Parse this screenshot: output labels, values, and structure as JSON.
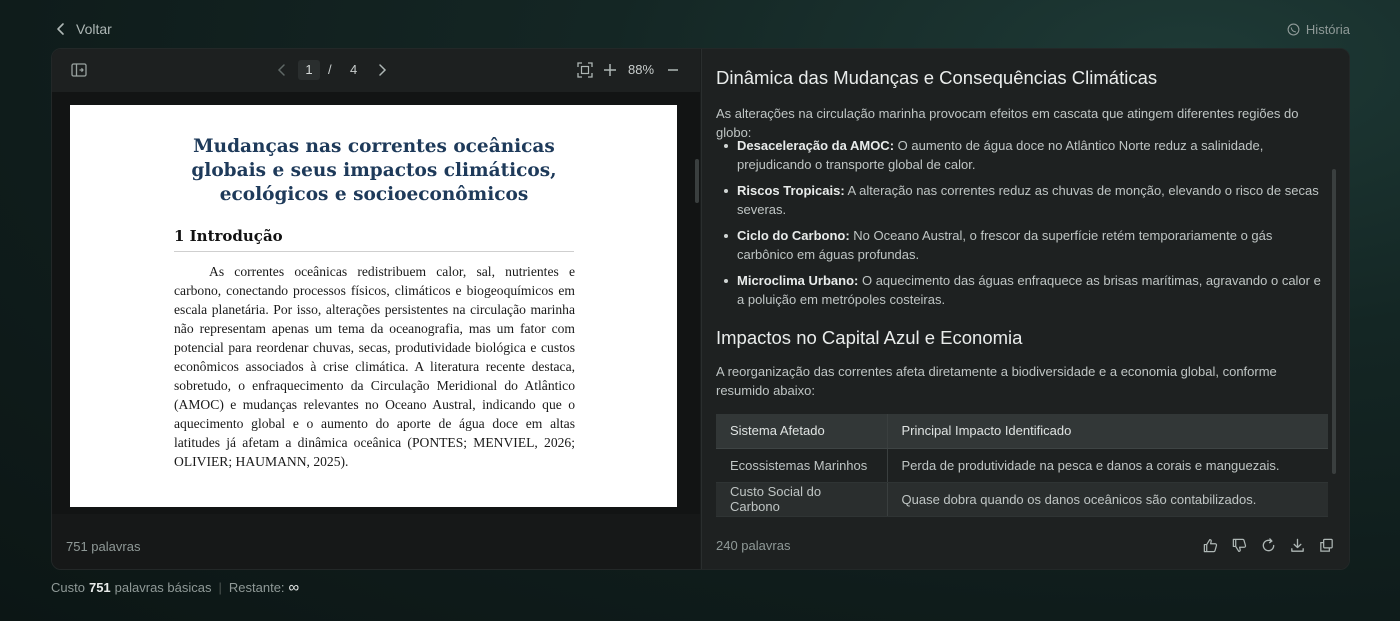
{
  "nav": {
    "back_label": "Voltar",
    "history_label": "História"
  },
  "viewer": {
    "current_page": "1",
    "page_separator": "/",
    "total_pages": "4",
    "zoom": "88%",
    "word_count": "751 palavras"
  },
  "document": {
    "title": "Mudanças nas correntes oceânicas globais e seus impactos climáticos, ecológicos e socioeconômicos",
    "section_heading": "1 Introdução",
    "body": "As correntes oceânicas redistribuem calor, sal, nutrientes e carbono, conectando processos físicos, climáticos e biogeoquímicos em escala planetária. Por isso, alterações persistentes na circulação marinha não representam apenas um tema da oceanografia, mas um fator com potencial para reordenar chuvas, secas, produtividade biológica e custos econômicos associados à crise climática. A literatura recente destaca, sobretudo, o enfraquecimento da Circulação Meridional do Atlântico (AMOC) e mudanças relevantes no Oceano Austral, indicando que o aquecimento global e o aumento do aporte de água doce em altas latitudes já afetam a dinâmica oceânica (PONTES; MENVIEL, 2026; OLIVIER; HAUMANN, 2025)."
  },
  "summary": {
    "heading1": "Dinâmica das Mudanças e Consequências Climáticas",
    "intro1": "As alterações na circulação marinha provocam efeitos em cascata que atingem diferentes regiões do globo:",
    "bullets": [
      {
        "term": "Desaceleração da AMOC:",
        "text": " O aumento de água doce no Atlântico Norte reduz a salinidade, prejudicando o transporte global de calor."
      },
      {
        "term": "Riscos Tropicais:",
        "text": " A alteração nas correntes reduz as chuvas de monção, elevando o risco de secas severas."
      },
      {
        "term": "Ciclo do Carbono:",
        "text": " No Oceano Austral, o frescor da superfície retém temporariamente o gás carbônico em águas profundas."
      },
      {
        "term": "Microclima Urbano:",
        "text": " O aquecimento das águas enfraquece as brisas marítimas, agravando o calor e a poluição em metrópoles costeiras."
      }
    ],
    "heading2": "Impactos no Capital Azul e Economia",
    "intro2": "A reorganização das correntes afeta diretamente a biodiversidade e a economia global, conforme resumido abaixo:",
    "table": {
      "headers": [
        "Sistema Afetado",
        "Principal Impacto Identificado"
      ],
      "rows": [
        [
          "Ecossistemas Marinhos",
          "Perda de produtividade na pesca e danos a corais e manguezais."
        ],
        [
          "Custo Social do Carbono",
          "Quase dobra quando os danos oceânicos são contabilizados."
        ]
      ]
    },
    "word_count": "240 palavras"
  },
  "footer": {
    "cost_prefix": "Custo",
    "cost_value": "751",
    "cost_suffix": "palavras básicas",
    "separator": "|",
    "remaining_label": "Restante:",
    "remaining_value": "∞"
  },
  "icons": {
    "back": "chevron-left-icon",
    "history": "whatsapp-history-icon",
    "sidebar": "sidebar-toggle-icon",
    "fit": "fit-screen-icon",
    "like": "thumbs-up-icon",
    "dislike": "thumbs-down-icon",
    "regenerate": "refresh-icon",
    "download": "download-icon",
    "copy": "copy-icon"
  }
}
